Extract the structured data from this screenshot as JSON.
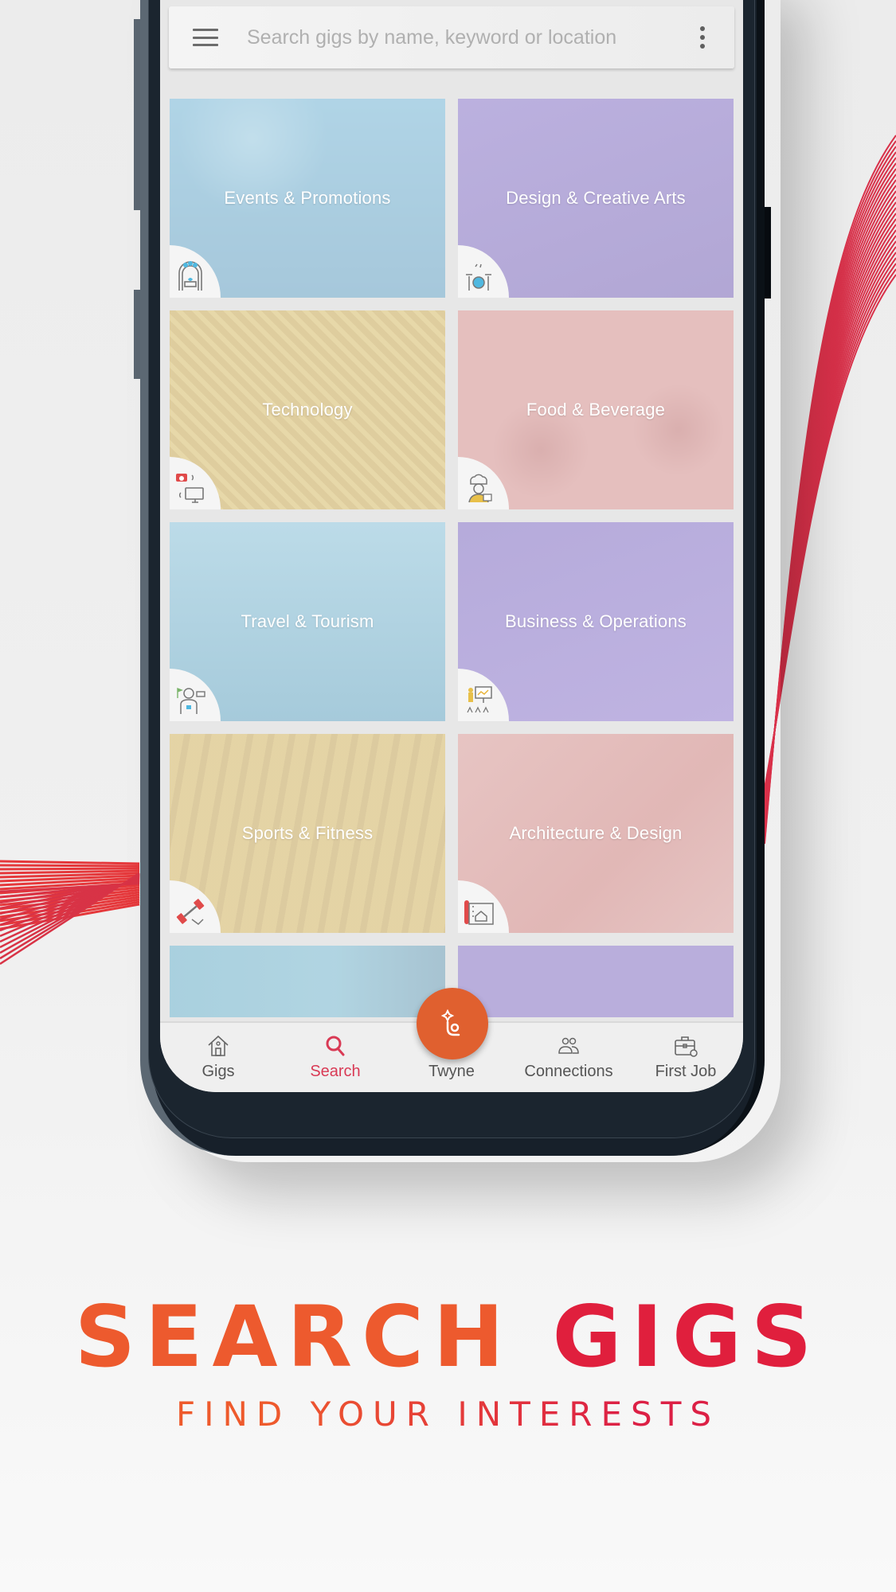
{
  "search": {
    "placeholder": "Search gigs by name, keyword or location",
    "value": ""
  },
  "categories": [
    {
      "label": "Events & Promotions",
      "color": "#3aa6dc",
      "icon": "wedding-arch-icon"
    },
    {
      "label": "Design & Creative Arts",
      "color": "#5b3cc0",
      "icon": "drum-kit-icon"
    },
    {
      "label": "Technology",
      "color": "#d7a51e",
      "icon": "cctv-computer-icon"
    },
    {
      "label": "Food & Beverage",
      "color": "#e16a66",
      "icon": "chef-icon"
    },
    {
      "label": "Travel & Tourism",
      "color": "#37a3cf",
      "icon": "traveler-icon"
    },
    {
      "label": "Business & Operations",
      "color": "#6545c6",
      "icon": "presentation-icon"
    },
    {
      "label": "Sports & Fitness",
      "color": "#d9a61f",
      "icon": "dumbbell-icon"
    },
    {
      "label": "Architecture & Design",
      "color": "#e0706b",
      "icon": "blueprint-house-icon"
    },
    {
      "label": "",
      "color": "#36a6cf",
      "icon": ""
    },
    {
      "label": "",
      "color": "#6444c8",
      "icon": ""
    }
  ],
  "bottom_nav": {
    "items": [
      {
        "label": "Gigs",
        "icon": "home-icon",
        "active": false
      },
      {
        "label": "Search",
        "icon": "search-icon",
        "active": true
      },
      {
        "label": "Twyne",
        "icon": "twyne-logo-icon",
        "active": false
      },
      {
        "label": "Connections",
        "icon": "people-icon",
        "active": false
      },
      {
        "label": "First Job",
        "icon": "briefcase-gear-icon",
        "active": false
      }
    ]
  },
  "promo": {
    "headline_word1": "SEARCH",
    "headline_word2": "GIGS",
    "subline": "FIND YOUR INTERESTS"
  },
  "colors": {
    "accent_orange": "#e0602f",
    "accent_red": "#d93a55",
    "headline_orange": "#ed5a2e",
    "headline_red": "#e01f3d"
  }
}
